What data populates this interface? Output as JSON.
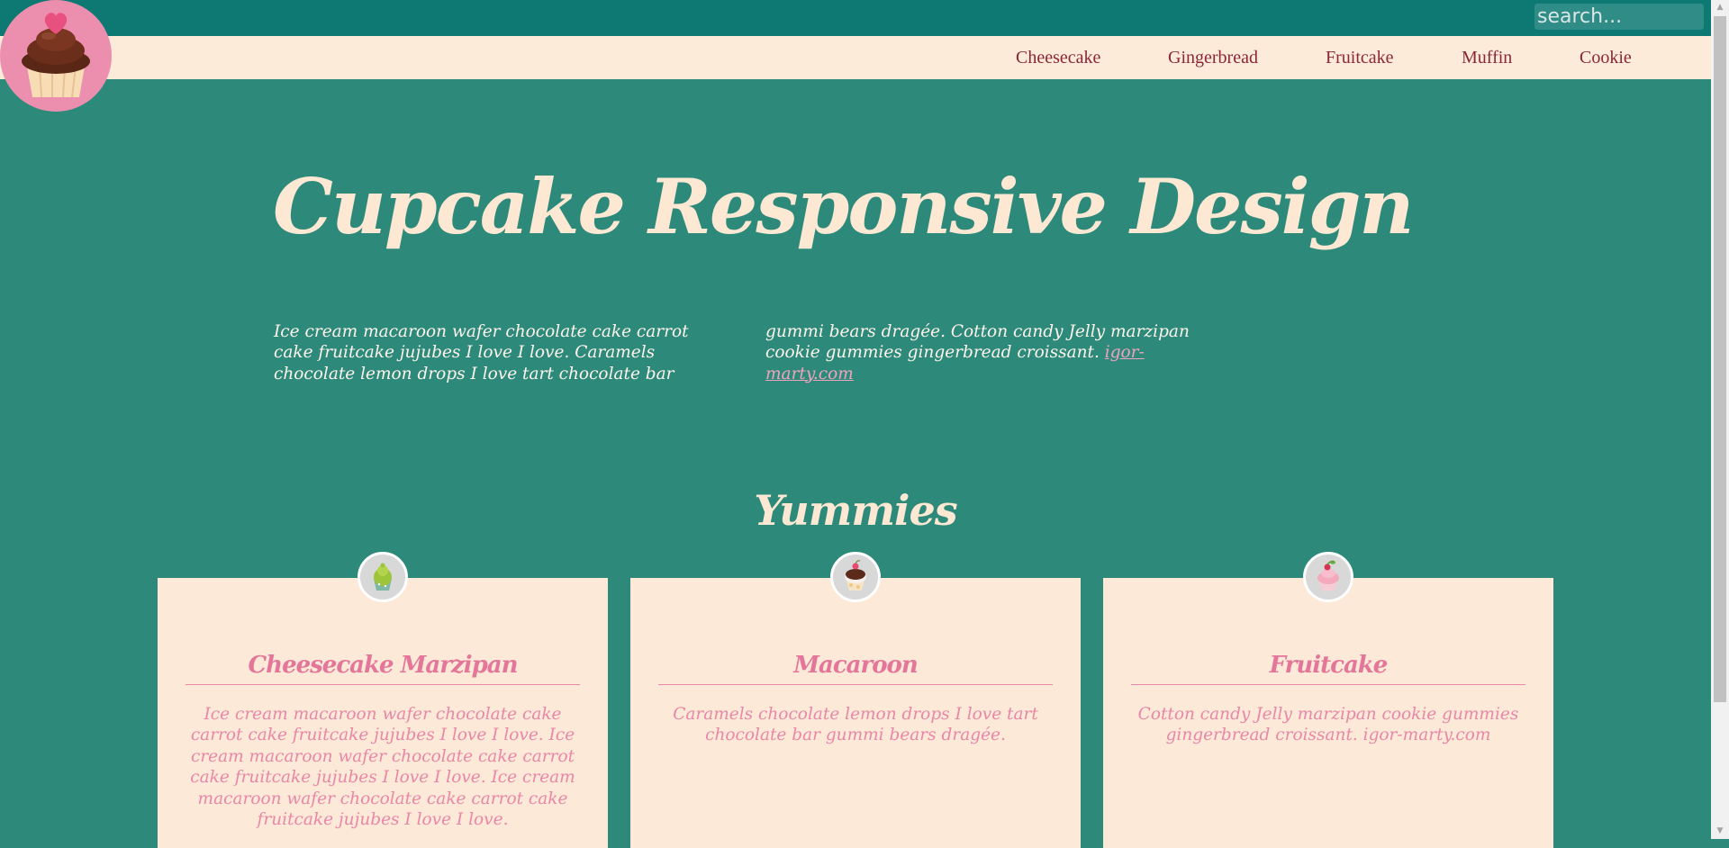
{
  "search": {
    "placeholder": "search..."
  },
  "nav": {
    "items": [
      {
        "label": "Cheesecake"
      },
      {
        "label": "Gingerbread"
      },
      {
        "label": "Fruitcake"
      },
      {
        "label": "Muffin"
      },
      {
        "label": "Cookie"
      }
    ]
  },
  "hero": {
    "title": "Cupcake Responsive Design",
    "text": "Ice cream macaroon wafer chocolate cake carrot cake fruitcake jujubes I love I love. Caramels chocolate lemon drops I love tart chocolate bar gummi bears dragée. Cotton candy Jelly marzipan cookie gummies gingerbread croissant.",
    "link": "igor-marty.com"
  },
  "section": {
    "title": "Yummies"
  },
  "cards": [
    {
      "icon": "cupcake-green-icon",
      "title": "Cheesecake Marzipan",
      "text": "Ice cream macaroon wafer chocolate cake carrot cake fruitcake jujubes I love I love. Ice cream macaroon wafer chocolate cake carrot cake fruitcake jujubes I love I love. Ice cream macaroon wafer chocolate cake carrot cake fruitcake jujubes I love I love."
    },
    {
      "icon": "cupcake-chocolate-icon",
      "title": "Macaroon",
      "text": "Caramels chocolate lemon drops I love tart chocolate bar gummi bears dragée."
    },
    {
      "icon": "cupcake-pink-icon",
      "title": "Fruitcake",
      "text": "Cotton candy Jelly marzipan cookie gummies gingerbread croissant. igor-marty.com"
    }
  ],
  "colors": {
    "topbar": "#0e7872",
    "background": "#2d8a7b",
    "navbar": "#fdebd9",
    "nav_text": "#8b2637",
    "accent_pink": "#e4769a",
    "cream": "#fde8d4",
    "logo_circle": "#ec8fae"
  }
}
